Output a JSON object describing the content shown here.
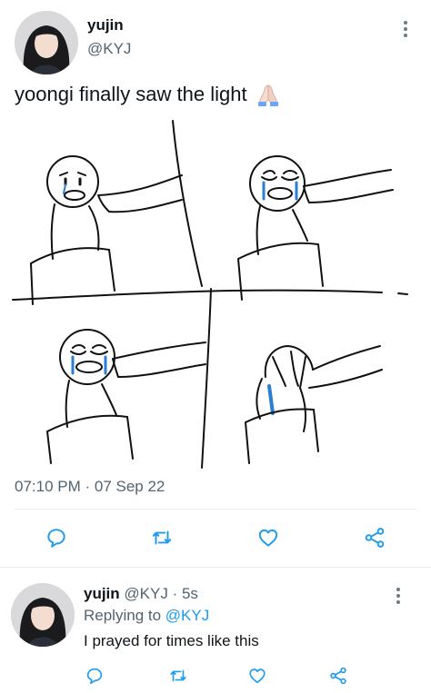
{
  "main_tweet": {
    "author_name": "yujin",
    "author_handle": "@KYJ",
    "text": "yoongi finally saw the light",
    "emoji_name": "folded-hands-icon",
    "timestamp": "07:10 PM · 07 Sep 22"
  },
  "actions": {
    "icons": [
      "reply-icon",
      "retweet-icon",
      "like-icon",
      "share-icon"
    ]
  },
  "reply": {
    "author_name": "yujin",
    "author_handle": "@KYJ",
    "time": "· 5s",
    "replying_to_label": "Replying to",
    "replying_to_handle": "@KYJ",
    "text": "I prayed for times like this"
  },
  "colors": {
    "text_primary": "#0f1419",
    "text_secondary": "#536471",
    "link": "#1d9bf0",
    "icon": "#1d9bf0"
  }
}
